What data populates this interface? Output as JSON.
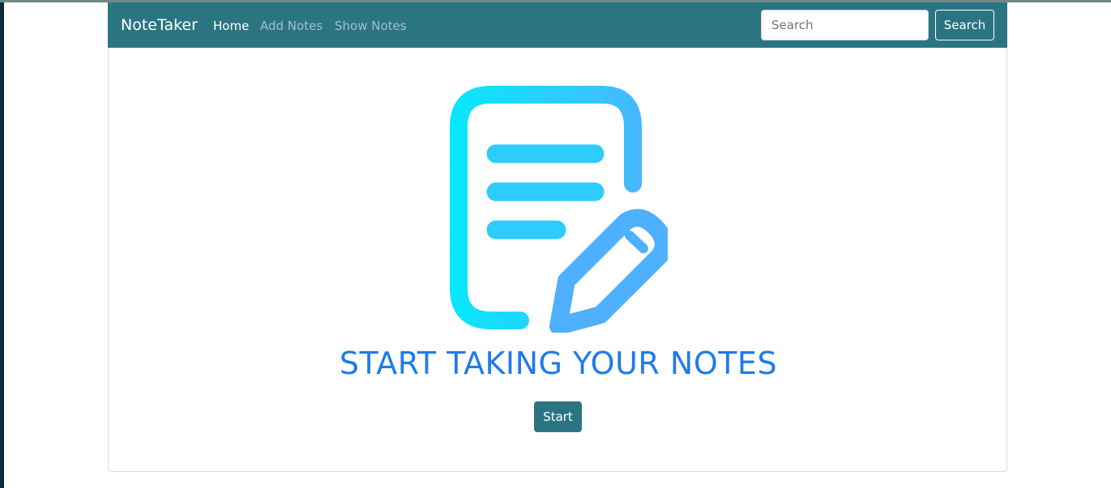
{
  "navbar": {
    "brand": "NoteTaker",
    "links": [
      {
        "label": "Home",
        "active": true
      },
      {
        "label": "Add Notes",
        "active": false
      },
      {
        "label": "Show Notes",
        "active": false
      }
    ],
    "search": {
      "placeholder": "Search",
      "value": "",
      "button_label": "Search"
    }
  },
  "main": {
    "icon": "note-edit-icon",
    "headline": "START TAKING YOUR NOTES",
    "start_label": "Start"
  },
  "colors": {
    "navbar_bg": "#2b7583",
    "headline": "#1f7bea",
    "icon_gradient_start": "#06e8fb",
    "icon_gradient_end": "#4fb0fd"
  }
}
